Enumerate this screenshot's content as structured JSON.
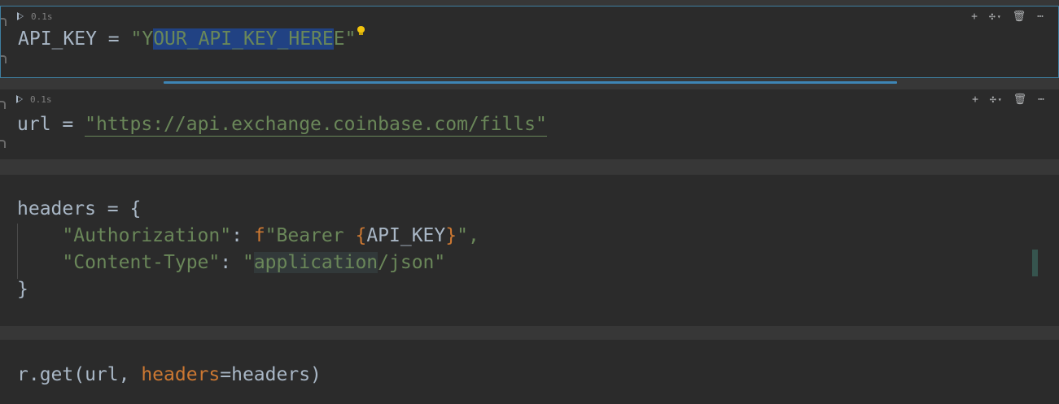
{
  "cells": [
    {
      "exec_time": "0.1s",
      "code": {
        "var": "API_KEY",
        "op": " = ",
        "quote_open": "\"Y",
        "selected": "OUR_API_KEY_HERE",
        "quote_close": "E\""
      }
    },
    {
      "exec_time": "0.1s",
      "code": {
        "var": "url",
        "op": " = ",
        "quote_open": "\"",
        "url": "https://api.exchange.coinbase.com/fills",
        "quote_close": "\""
      }
    },
    {
      "code": {
        "line1": "headers = {",
        "auth_key": "\"Authorization\"",
        "colon": ": ",
        "fprefix": "f",
        "auth_val_start": "\"Bearer ",
        "brace_open": "{",
        "auth_var": "API_KEY",
        "brace_close": "}",
        "auth_val_end": "\",",
        "ct_key": "\"Content-Type\"",
        "ct_val_q": "\"",
        "ct_val_hl": "application",
        "ct_val_rest": "/json\"",
        "line4": "}"
      }
    },
    {
      "code": {
        "prefix": "r.get(url, ",
        "kwarg": "headers",
        "suffix": "=headers)"
      }
    }
  ],
  "toolbar": {
    "add_icon": "plus-icon",
    "split_icon": "gear-icon",
    "delete_icon": "trash-icon",
    "more_icon": "more-icon"
  },
  "colors": {
    "string": "#6a8759",
    "keyword": "#cc7832",
    "default": "#a9b7c6",
    "selection": "#214283",
    "active_border": "#3e7ea0"
  }
}
